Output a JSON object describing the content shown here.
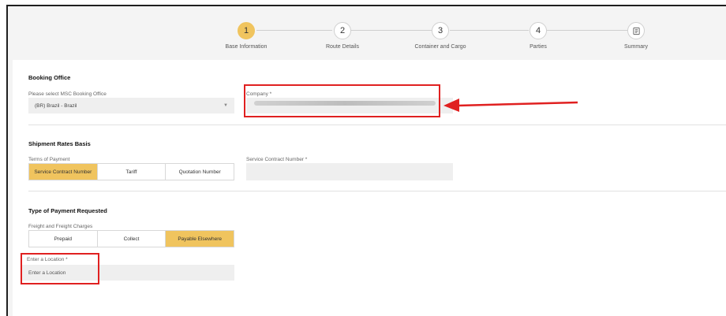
{
  "stepper": {
    "steps": [
      {
        "number": "1",
        "label": "Base Information"
      },
      {
        "number": "2",
        "label": "Route Details"
      },
      {
        "number": "3",
        "label": "Container and Cargo"
      },
      {
        "number": "4",
        "label": "Parties"
      },
      {
        "label": "Summary",
        "icon": "summary-icon"
      }
    ]
  },
  "booking_office": {
    "title": "Booking Office",
    "select_label": "Please select MSC Booking Office",
    "select_value": "(BR) Brazil - Brazil",
    "company_label": "Company *"
  },
  "shipment_rates": {
    "title": "Shipment Rates Basis",
    "terms_label": "Terms of Payment",
    "terms_options": [
      "Service Contract Number",
      "Tariff",
      "Quotation Number"
    ],
    "terms_selected": "Service Contract Number",
    "contract_label": "Service Contract Number *"
  },
  "payment_type": {
    "title": "Type of Payment Requested",
    "charges_label": "Freight and Freight Charges",
    "charges_options": [
      "Prepaid",
      "Collect",
      "Payable Elsewhere"
    ],
    "charges_selected": "Payable Elsewhere",
    "location_label": "Enter a Location *",
    "location_placeholder": "Enter a Location"
  },
  "colors": {
    "accent": "#f0c45e",
    "annotation": "#e02020"
  }
}
